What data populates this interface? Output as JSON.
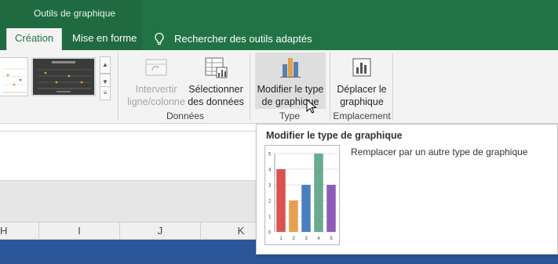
{
  "title_bar": {
    "contextual_group": "Outils de graphique"
  },
  "tabs": [
    {
      "label": "Création",
      "active": true
    },
    {
      "label": "Mise en forme",
      "active": false
    }
  ],
  "tell_me": {
    "label": "Rechercher des outils adaptés",
    "icon": "lightbulb-icon"
  },
  "ribbon": {
    "switch_row_col": {
      "label_line1": "Intervertir",
      "label_line2": "ligne/colonne",
      "enabled": false
    },
    "select_data": {
      "label_line1": "Sélectionner",
      "label_line2": "des données"
    },
    "group_data": "Données",
    "change_chart_type": {
      "label_line1": "Modifier le type",
      "label_line2": "de graphique"
    },
    "group_type": "Type",
    "move_chart": {
      "label_line1": "Déplacer le",
      "label_line2": "graphique"
    },
    "group_location": "Emplacement"
  },
  "columns": [
    "H",
    "I",
    "J",
    "K"
  ],
  "tooltip": {
    "title": "Modifier le type de graphique",
    "description": "Remplacer par un autre type de graphique"
  },
  "chart_data": {
    "type": "bar",
    "categories": [
      "1",
      "2",
      "3",
      "4",
      "5"
    ],
    "values": [
      4,
      2,
      3,
      5,
      3
    ],
    "ylim": [
      0,
      5
    ],
    "yticks": [
      "0",
      "1",
      "2",
      "3",
      "4",
      "5"
    ],
    "bar_colors": [
      "#d9534f",
      "#e8a050",
      "#4a7fbf",
      "#6aab8e",
      "#8e5cb8"
    ]
  },
  "colors": {
    "accent": "#217346",
    "ribbon_bg": "#f3f3f3",
    "statusbar": "#2b579a"
  }
}
